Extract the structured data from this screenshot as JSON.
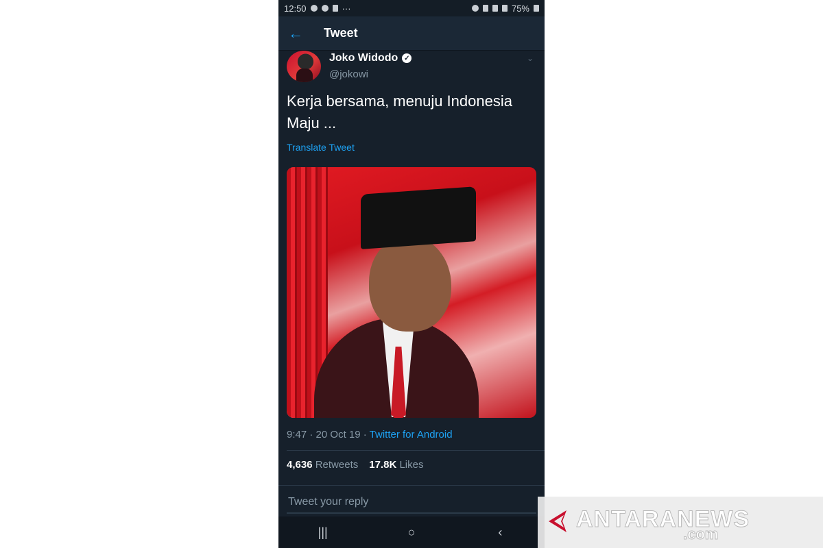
{
  "status_bar": {
    "time": "12:50",
    "overflow": "···",
    "battery": "75%"
  },
  "app_bar": {
    "title": "Tweet",
    "back_icon": "arrow-left-icon"
  },
  "tweet": {
    "author_name": "Joko Widodo",
    "verified_mark": "✓",
    "author_handle": "@jokowi",
    "text_line1": "Kerja bersama, menuju Indonesia",
    "text_line2": "Maju ...",
    "translate_label": "Translate Tweet",
    "time": "9:47",
    "date": "20 Oct 19",
    "separator": "·",
    "source": "Twitter for Android",
    "retweets_count": "4,636",
    "retweets_label": "Retweets",
    "likes_count": "17.8K",
    "likes_label": "Likes"
  },
  "reply": {
    "placeholder": "Tweet your reply"
  },
  "nav": {
    "recents": "|||",
    "home": "○",
    "back": "‹"
  },
  "watermark": {
    "brand": "ANTARANEWS",
    "tld": ".com"
  },
  "colors": {
    "accent": "#1da1f2",
    "background": "#16202b",
    "muted": "#8899a6"
  }
}
